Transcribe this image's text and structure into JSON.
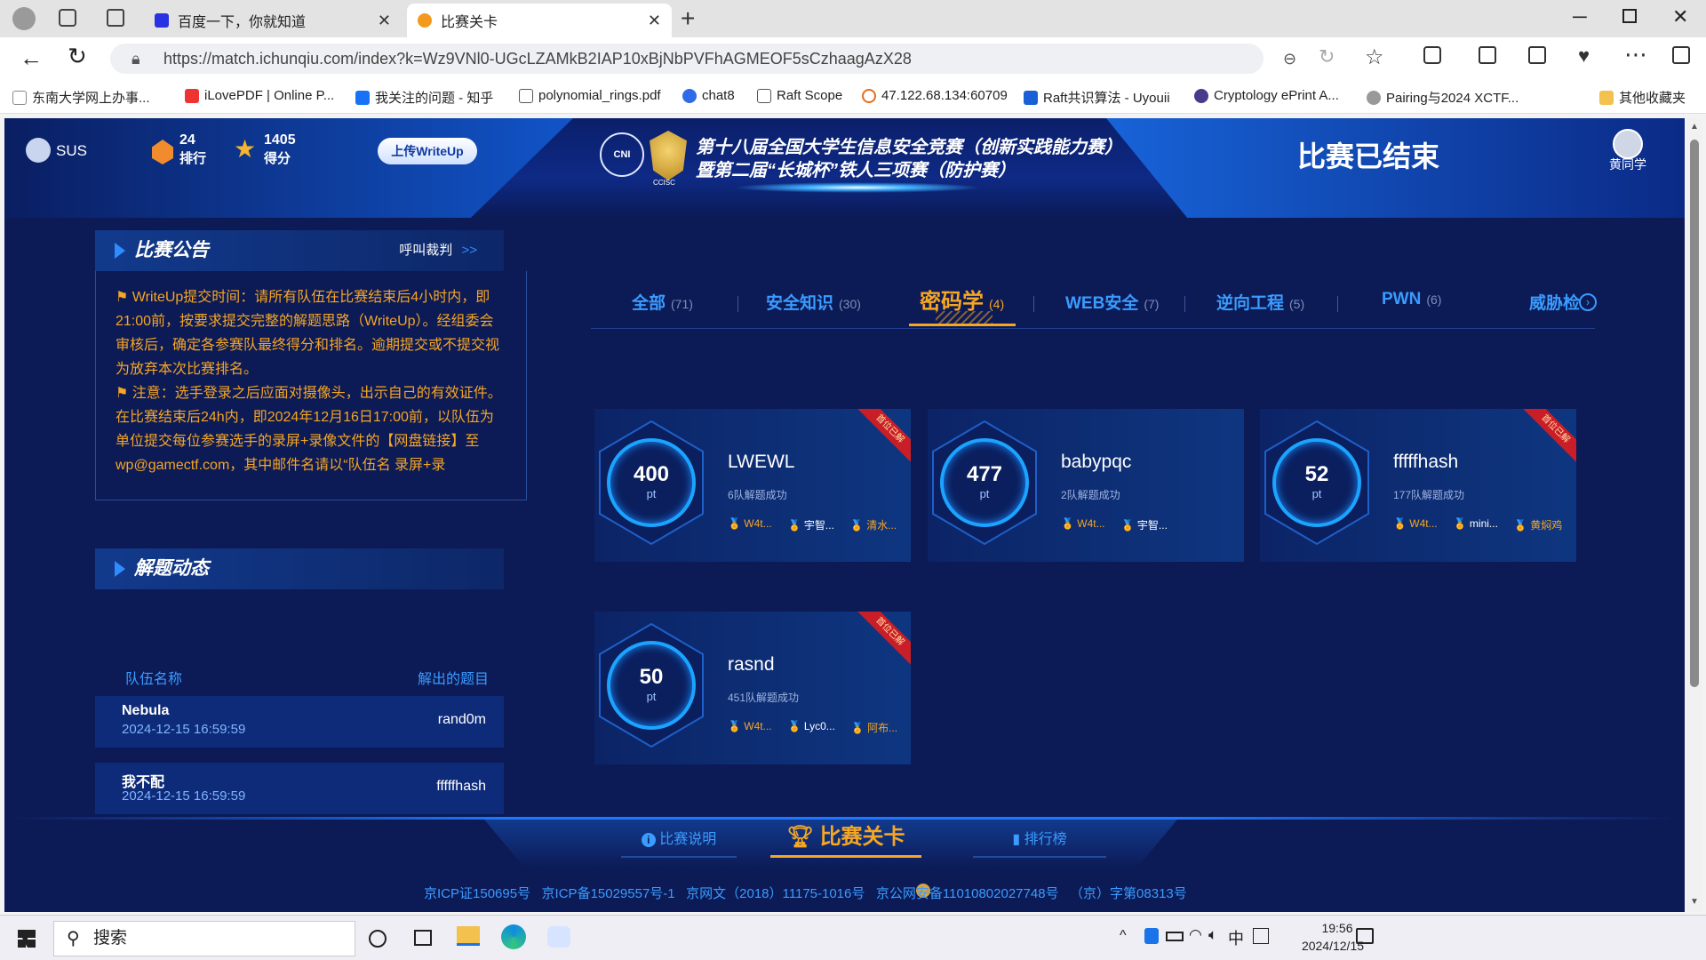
{
  "browser": {
    "tabs": [
      {
        "label": "百度一下，你就知道",
        "active": false
      },
      {
        "label": "比赛关卡",
        "active": true
      }
    ],
    "url": "https://match.ichunqiu.com/index?k=Wz9VNl0-UGcLZAMkB2IAP10xBjNbPVFhAGMEOF5sCzhaagAzX28",
    "bookmarks": [
      "东南大学网上办事...",
      "iLovePDF | Online P...",
      "我关注的问题 - 知乎",
      "polynomial_rings.pdf",
      "chat8",
      "Raft Scope",
      "47.122.68.134:60709",
      "Raft共识算法 - Uyouii",
      "Cryptology ePrint A...",
      "Pairing与2024 XCTF..."
    ],
    "other_bookmarks": "其他收藏夹"
  },
  "header": {
    "user": "SUS",
    "rank_value": "24",
    "rank_label": "排行",
    "score_value": "1405",
    "score_label": "得分",
    "upload_button": "上传WriteUp",
    "logo_text1": "CNI",
    "logo_text2": "CCISC",
    "title_line1": "第十八届全国大学生信息安全竞赛（创新实践能力赛）",
    "title_line2": "暨第二届“长城杯”铁人三项赛（防护赛）",
    "status": "比赛已结束",
    "account_name": "黄同学"
  },
  "announcement": {
    "title": "比赛公告",
    "call_referee": "呼叫裁判",
    "call_arrow": ">>",
    "text1": "WriteUp提交时间：请所有队伍在比赛结束后4小时内，即21:00前，按要求提交完整的解题思路（WriteUp）。经组委会审核后，确定各参赛队最终得分和排名。逾期提交或不提交视为放弃本次比赛排名。",
    "text2": "注意：选手登录之后应面对摄像头，出示自己的有效证件。在比赛结束后24h内，即2024年12月16日17:00前，以队伍为单位提交每位参赛选手的录屏+录像文件的【网盘链接】至wp@gamectf.com，其中邮件名请以“队伍名 录屏+录"
  },
  "solves": {
    "title": "解题动态",
    "col_team": "队伍名称",
    "col_problem": "解出的题目",
    "rows": [
      {
        "team": "Nebula",
        "time": "2024-12-15 16:59:59",
        "problem": "rand0m"
      },
      {
        "team": "我不配",
        "time": "2024-12-15 16:59:59",
        "problem": "fffffhash"
      }
    ]
  },
  "categories": [
    {
      "label": "全部",
      "count": "(71)",
      "active": false
    },
    {
      "label": "安全知识",
      "count": "(30)",
      "active": false
    },
    {
      "label": "密码学",
      "count": "(4)",
      "active": true
    },
    {
      "label": "WEB安全",
      "count": "(7)",
      "active": false
    },
    {
      "label": "逆向工程",
      "count": "(5)",
      "active": false
    },
    {
      "label": "PWN",
      "count": "(6)",
      "active": false
    },
    {
      "label": "威胁检",
      "count": "",
      "active": false
    }
  ],
  "challenges": [
    {
      "name": "LWEWL",
      "score": "400",
      "unit": "pt",
      "solved": "6队解题成功",
      "ribbon": "首位已解",
      "solvers": [
        "W4t...",
        "宇智...",
        "清水..."
      ]
    },
    {
      "name": "babypqc",
      "score": "477",
      "unit": "pt",
      "solved": "2队解题成功",
      "ribbon": "",
      "solvers": [
        "W4t...",
        "宇智..."
      ]
    },
    {
      "name": "fffffhash",
      "score": "52",
      "unit": "pt",
      "solved": "177队解题成功",
      "ribbon": "首位已解",
      "solvers": [
        "W4t...",
        "mini...",
        "黄焖鸡"
      ]
    },
    {
      "name": "rasnd",
      "score": "50",
      "unit": "pt",
      "solved": "451队解题成功",
      "ribbon": "首位已解",
      "solvers": [
        "W4t...",
        "Lyc0...",
        "阿布..."
      ]
    }
  ],
  "bottom_nav": {
    "explain": "比赛说明",
    "levels": "比赛关卡",
    "ranking": "排行榜"
  },
  "footer": "京ICP证150695号   京ICP备15029557号-1   京网文（2018）11175-1016号   京公网安备11010802027748号   （京）字第08313号",
  "taskbar": {
    "search": "搜索",
    "ime": "中",
    "time": "19:56",
    "date": "2024/12/15"
  }
}
